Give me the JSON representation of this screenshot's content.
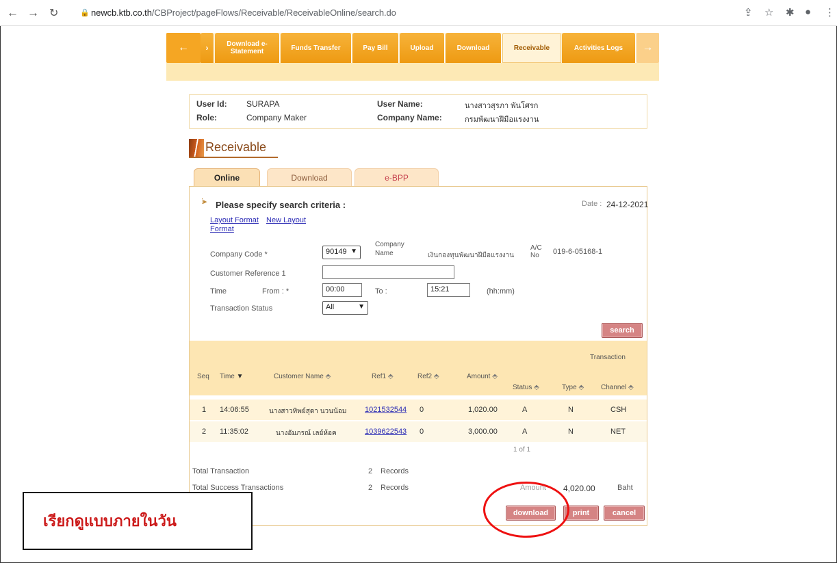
{
  "browser": {
    "url_host": "newcb.ktb.co.th",
    "url_path": "/CBProject/pageFlows/Receivable/ReceivableOnline/search.do"
  },
  "menu": {
    "tabs": [
      "Download e-Statement",
      "Funds Transfer",
      "Pay Bill",
      "Upload",
      "Download",
      "Receivable",
      "Activities Logs"
    ],
    "active": "Receivable"
  },
  "user": {
    "user_id_label": "User Id:",
    "user_id": "SURAPA",
    "role_label": "Role:",
    "role": "Company Maker",
    "user_name_label": "User Name:",
    "user_name": "นางสาวสุรภา พันโศรก",
    "company_name_label": "Company Name:",
    "company_name": "กรมพัฒนาฝีมือแรงงาน"
  },
  "page_title": "Receivable",
  "sub_tabs": [
    "Online",
    "Download",
    "e-BPP"
  ],
  "search": {
    "heading": "Please specify search criteria :",
    "date_label": "Date :",
    "date": "24-12-2021",
    "link_layout_format": "Layout Format",
    "link_new_layout": "New Layout",
    "link_format": "Format",
    "company_code_label": "Company Code *",
    "company_code": "90149",
    "company_name_label_1": "Company",
    "company_name_label_2": "Name",
    "company_name": "เงินกองทุนพัฒนาฝีมือแรงงาน",
    "ac_label_1": "A/C",
    "ac_label_2": "No",
    "ac_no": "019-6-05168-1",
    "customer_ref_label": "Customer Reference 1",
    "customer_ref_value": "",
    "time_label": "Time",
    "from_label": "From : *",
    "from_value": "00:00",
    "to_label": "To :",
    "to_value": "15:21",
    "time_hint": "(hh:mm)",
    "status_label": "Transaction Status",
    "status_value": "All",
    "search_button": "search"
  },
  "table": {
    "transaction_group": "Transaction",
    "columns": [
      "Seq",
      "Time",
      "Customer Name",
      "Ref1",
      "Ref2",
      "Amount",
      "Status",
      "Type",
      "Channel"
    ],
    "rows": [
      {
        "seq": "1",
        "time": "14:06:55",
        "customer": "นางสาวทิพย์สุดา นวนน้อม",
        "ref1": "1021532544",
        "ref2": "0",
        "amount": "1,020.00",
        "status": "A",
        "type": "N",
        "channel": "CSH"
      },
      {
        "seq": "2",
        "time": "11:35:02",
        "customer": "นางอัมภรณ์ เลย์ห้อค",
        "ref1": "1039622543",
        "ref2": "0",
        "amount": "3,000.00",
        "status": "A",
        "type": "N",
        "channel": "NET"
      }
    ],
    "pagination": "1 of 1"
  },
  "totals": {
    "total_label": "Total Transaction",
    "total_count": "2",
    "records": "Records",
    "success_label": "Total Success Transactions",
    "success_count": "2",
    "amount_label": "Amount",
    "amount": "4,020.00",
    "currency": "Baht"
  },
  "actions": {
    "download": "download",
    "print": "print",
    "cancel": "cancel"
  },
  "annotation": {
    "callout": "เรียกดูแบบภายในวัน",
    "highlight_color": "#e11111"
  }
}
